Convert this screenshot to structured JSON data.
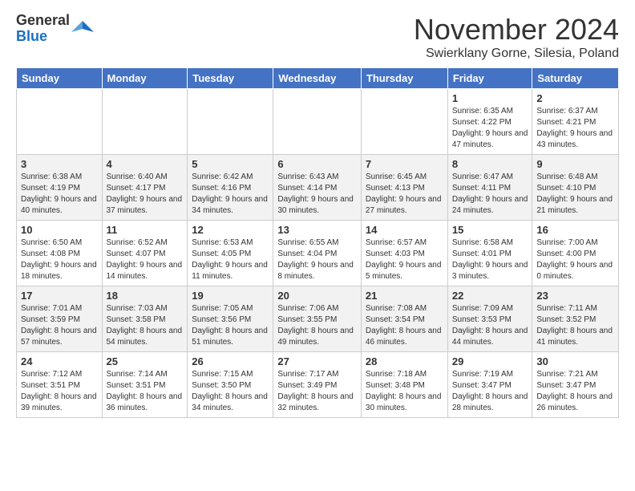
{
  "header": {
    "logo_general": "General",
    "logo_blue": "Blue",
    "month_title": "November 2024",
    "location": "Swierklany Gorne, Silesia, Poland"
  },
  "days_of_week": [
    "Sunday",
    "Monday",
    "Tuesday",
    "Wednesday",
    "Thursday",
    "Friday",
    "Saturday"
  ],
  "weeks": [
    [
      {
        "day": "",
        "sunrise": "",
        "sunset": "",
        "daylight": ""
      },
      {
        "day": "",
        "sunrise": "",
        "sunset": "",
        "daylight": ""
      },
      {
        "day": "",
        "sunrise": "",
        "sunset": "",
        "daylight": ""
      },
      {
        "day": "",
        "sunrise": "",
        "sunset": "",
        "daylight": ""
      },
      {
        "day": "",
        "sunrise": "",
        "sunset": "",
        "daylight": ""
      },
      {
        "day": "1",
        "sunrise": "Sunrise: 6:35 AM",
        "sunset": "Sunset: 4:22 PM",
        "daylight": "Daylight: 9 hours and 47 minutes."
      },
      {
        "day": "2",
        "sunrise": "Sunrise: 6:37 AM",
        "sunset": "Sunset: 4:21 PM",
        "daylight": "Daylight: 9 hours and 43 minutes."
      }
    ],
    [
      {
        "day": "3",
        "sunrise": "Sunrise: 6:38 AM",
        "sunset": "Sunset: 4:19 PM",
        "daylight": "Daylight: 9 hours and 40 minutes."
      },
      {
        "day": "4",
        "sunrise": "Sunrise: 6:40 AM",
        "sunset": "Sunset: 4:17 PM",
        "daylight": "Daylight: 9 hours and 37 minutes."
      },
      {
        "day": "5",
        "sunrise": "Sunrise: 6:42 AM",
        "sunset": "Sunset: 4:16 PM",
        "daylight": "Daylight: 9 hours and 34 minutes."
      },
      {
        "day": "6",
        "sunrise": "Sunrise: 6:43 AM",
        "sunset": "Sunset: 4:14 PM",
        "daylight": "Daylight: 9 hours and 30 minutes."
      },
      {
        "day": "7",
        "sunrise": "Sunrise: 6:45 AM",
        "sunset": "Sunset: 4:13 PM",
        "daylight": "Daylight: 9 hours and 27 minutes."
      },
      {
        "day": "8",
        "sunrise": "Sunrise: 6:47 AM",
        "sunset": "Sunset: 4:11 PM",
        "daylight": "Daylight: 9 hours and 24 minutes."
      },
      {
        "day": "9",
        "sunrise": "Sunrise: 6:48 AM",
        "sunset": "Sunset: 4:10 PM",
        "daylight": "Daylight: 9 hours and 21 minutes."
      }
    ],
    [
      {
        "day": "10",
        "sunrise": "Sunrise: 6:50 AM",
        "sunset": "Sunset: 4:08 PM",
        "daylight": "Daylight: 9 hours and 18 minutes."
      },
      {
        "day": "11",
        "sunrise": "Sunrise: 6:52 AM",
        "sunset": "Sunset: 4:07 PM",
        "daylight": "Daylight: 9 hours and 14 minutes."
      },
      {
        "day": "12",
        "sunrise": "Sunrise: 6:53 AM",
        "sunset": "Sunset: 4:05 PM",
        "daylight": "Daylight: 9 hours and 11 minutes."
      },
      {
        "day": "13",
        "sunrise": "Sunrise: 6:55 AM",
        "sunset": "Sunset: 4:04 PM",
        "daylight": "Daylight: 9 hours and 8 minutes."
      },
      {
        "day": "14",
        "sunrise": "Sunrise: 6:57 AM",
        "sunset": "Sunset: 4:03 PM",
        "daylight": "Daylight: 9 hours and 5 minutes."
      },
      {
        "day": "15",
        "sunrise": "Sunrise: 6:58 AM",
        "sunset": "Sunset: 4:01 PM",
        "daylight": "Daylight: 9 hours and 3 minutes."
      },
      {
        "day": "16",
        "sunrise": "Sunrise: 7:00 AM",
        "sunset": "Sunset: 4:00 PM",
        "daylight": "Daylight: 9 hours and 0 minutes."
      }
    ],
    [
      {
        "day": "17",
        "sunrise": "Sunrise: 7:01 AM",
        "sunset": "Sunset: 3:59 PM",
        "daylight": "Daylight: 8 hours and 57 minutes."
      },
      {
        "day": "18",
        "sunrise": "Sunrise: 7:03 AM",
        "sunset": "Sunset: 3:58 PM",
        "daylight": "Daylight: 8 hours and 54 minutes."
      },
      {
        "day": "19",
        "sunrise": "Sunrise: 7:05 AM",
        "sunset": "Sunset: 3:56 PM",
        "daylight": "Daylight: 8 hours and 51 minutes."
      },
      {
        "day": "20",
        "sunrise": "Sunrise: 7:06 AM",
        "sunset": "Sunset: 3:55 PM",
        "daylight": "Daylight: 8 hours and 49 minutes."
      },
      {
        "day": "21",
        "sunrise": "Sunrise: 7:08 AM",
        "sunset": "Sunset: 3:54 PM",
        "daylight": "Daylight: 8 hours and 46 minutes."
      },
      {
        "day": "22",
        "sunrise": "Sunrise: 7:09 AM",
        "sunset": "Sunset: 3:53 PM",
        "daylight": "Daylight: 8 hours and 44 minutes."
      },
      {
        "day": "23",
        "sunrise": "Sunrise: 7:11 AM",
        "sunset": "Sunset: 3:52 PM",
        "daylight": "Daylight: 8 hours and 41 minutes."
      }
    ],
    [
      {
        "day": "24",
        "sunrise": "Sunrise: 7:12 AM",
        "sunset": "Sunset: 3:51 PM",
        "daylight": "Daylight: 8 hours and 39 minutes."
      },
      {
        "day": "25",
        "sunrise": "Sunrise: 7:14 AM",
        "sunset": "Sunset: 3:51 PM",
        "daylight": "Daylight: 8 hours and 36 minutes."
      },
      {
        "day": "26",
        "sunrise": "Sunrise: 7:15 AM",
        "sunset": "Sunset: 3:50 PM",
        "daylight": "Daylight: 8 hours and 34 minutes."
      },
      {
        "day": "27",
        "sunrise": "Sunrise: 7:17 AM",
        "sunset": "Sunset: 3:49 PM",
        "daylight": "Daylight: 8 hours and 32 minutes."
      },
      {
        "day": "28",
        "sunrise": "Sunrise: 7:18 AM",
        "sunset": "Sunset: 3:48 PM",
        "daylight": "Daylight: 8 hours and 30 minutes."
      },
      {
        "day": "29",
        "sunrise": "Sunrise: 7:19 AM",
        "sunset": "Sunset: 3:47 PM",
        "daylight": "Daylight: 8 hours and 28 minutes."
      },
      {
        "day": "30",
        "sunrise": "Sunrise: 7:21 AM",
        "sunset": "Sunset: 3:47 PM",
        "daylight": "Daylight: 8 hours and 26 minutes."
      }
    ]
  ]
}
